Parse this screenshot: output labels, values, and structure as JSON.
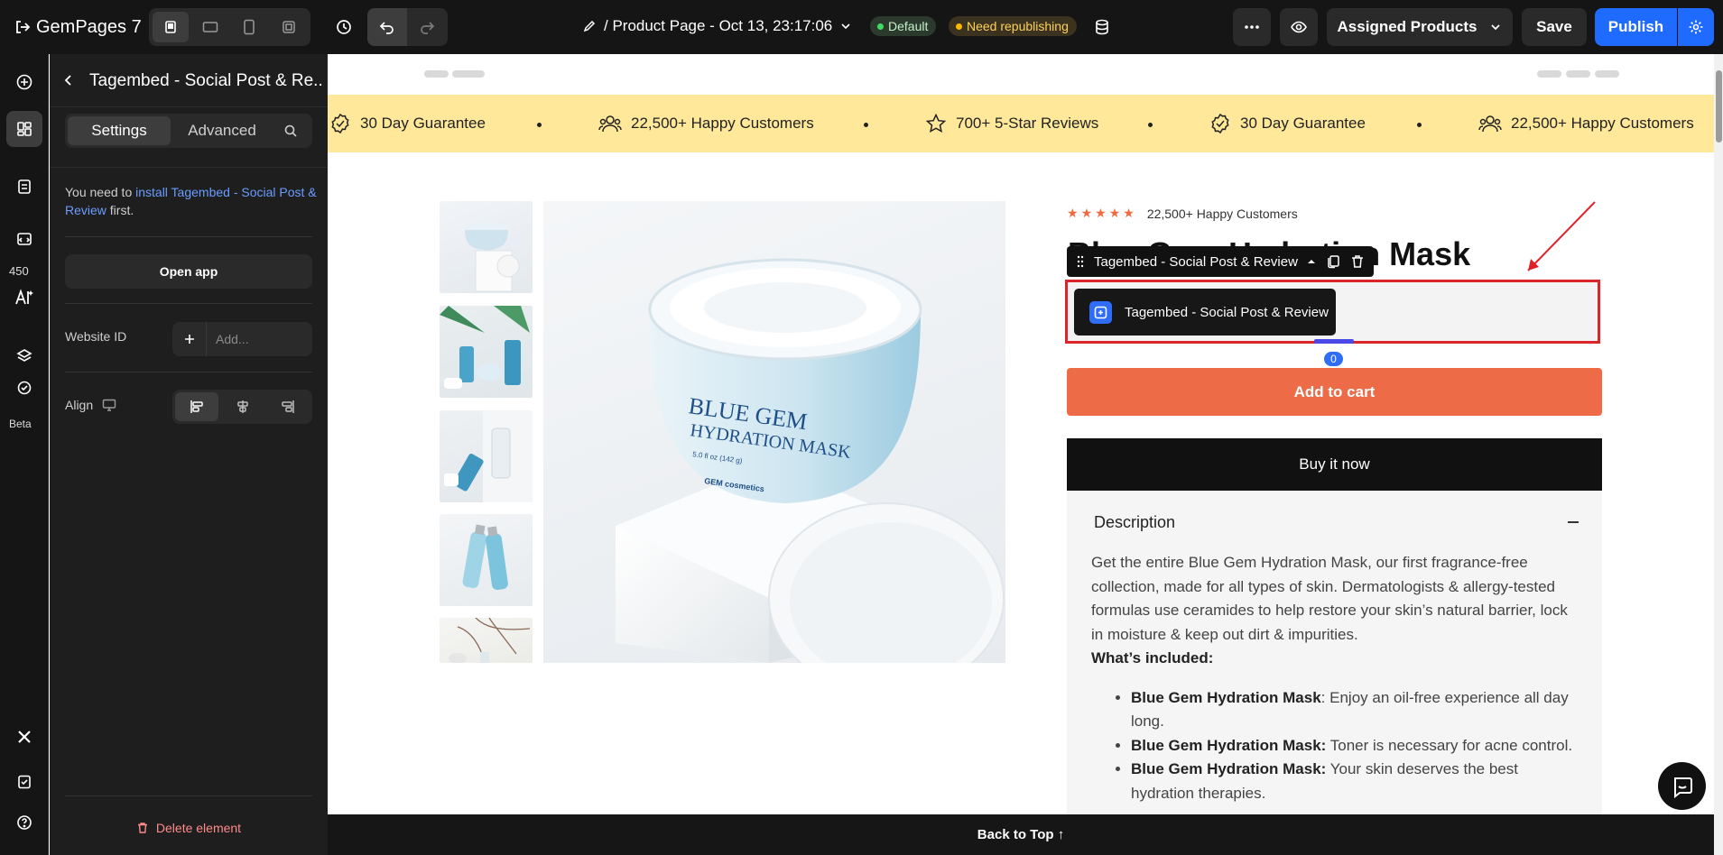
{
  "topbar": {
    "brand": "GemPages 7",
    "page_title": "/ Product Page - Oct 13, 23:17:06",
    "badge_default": "Default",
    "badge_status": "Need republishing",
    "assigned_products": "Assigned Products",
    "save": "Save",
    "publish": "Publish"
  },
  "rail": {
    "counter": "450",
    "beta": "Beta"
  },
  "panel": {
    "title": "Tagembed - Social Post & Re...",
    "tabs": [
      "Settings",
      "Advanced"
    ],
    "note_prefix": "You need to ",
    "note_link": "install Tagembed - Social Post & Review",
    "note_suffix": " first.",
    "open_app": "Open app",
    "website_id_label": "Website ID",
    "website_id_placeholder": "Add...",
    "align_label": "Align",
    "delete": "Delete element"
  },
  "ribbon": {
    "items": [
      "30 Day Guarantee",
      "22,500+ Happy Customers",
      "700+ 5-Star Reviews",
      "30 Day Guarantee",
      "22,500+ Happy Customers"
    ]
  },
  "product": {
    "rating_text": "22,500+ Happy Customers",
    "title": "Blue Gem Hydration Mask",
    "element_toolbar_label": "Tagembed - Social Post & Review",
    "app_chip_label": "Tagembed - Social Post & Review",
    "badge_count": "0",
    "add_to_cart": "Add to cart",
    "buy_now": "Buy it now",
    "description_heading": "Description",
    "description_paragraph": "Get the entire Blue Gem Hydration Mask, our first fragrance-free collection, made for all types of skin. Dermatologists & allergy-tested formulas use ceramides to help restore your skin’s natural barrier, lock in moisture & keep out dirt & impurities.",
    "included_heading": "What’s included:",
    "included_items": [
      {
        "bold": "Blue Gem Hydration Mask",
        "text": ": Enjoy an oil-free experience all day long."
      },
      {
        "bold": "Blue Gem Hydration Mask:",
        "text": " Toner is necessary for acne control."
      },
      {
        "bold": "Blue Gem Hydration Mask:",
        "text": " Your skin deserves the best hydration therapies."
      }
    ],
    "jar_brand_line1": "BLUE GEM",
    "jar_brand_line2": "HYDRATION MASK",
    "jar_size": "5.0 fl oz (142 g)",
    "jar_maker": "GEM cosmetics"
  },
  "footer": {
    "back_to_top": "Back to Top ↑"
  },
  "colors": {
    "accent": "#1f6bff",
    "cart": "#ee6b47",
    "ribbon": "#ffe89a",
    "selection": "#d9262c"
  }
}
